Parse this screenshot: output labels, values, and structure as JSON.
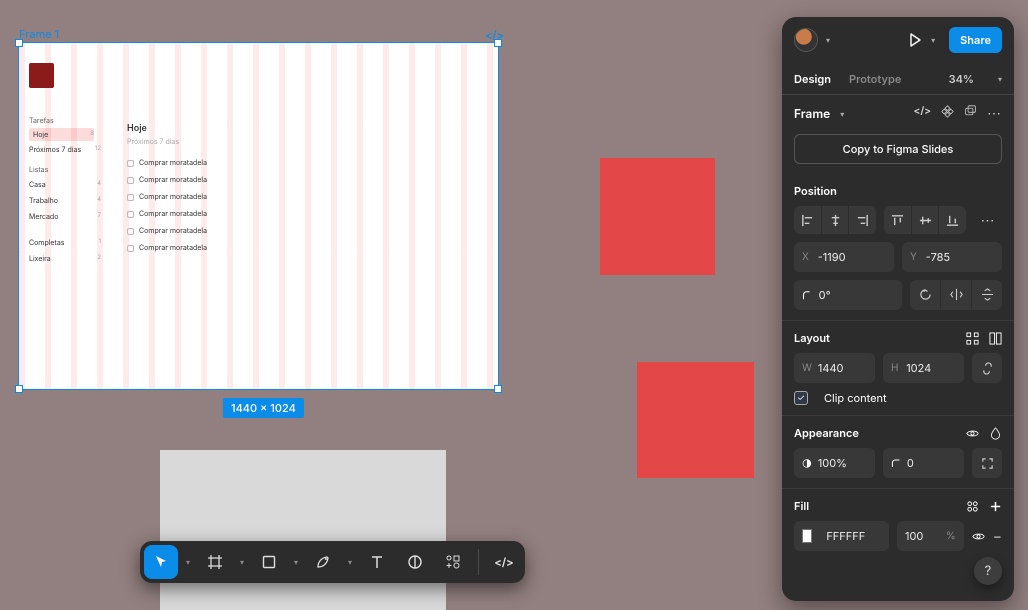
{
  "canvas": {
    "frame_label": "Frame 1",
    "dimensions_badge": "1440 × 1024",
    "mock": {
      "sidebar_h1": "Tarefas",
      "hoje": "Hoje",
      "hoje_n": "8",
      "proximos": "Próximos 7 dias",
      "proximos_n": "12",
      "sidebar_h2": "Listas",
      "casa": "Casa",
      "casa_n": "4",
      "trabalho": "Trabalho",
      "trabalho_n": "4",
      "mercado": "Mercado",
      "mercado_n": "7",
      "completas": "Completas",
      "completas_n": "1",
      "lixeira": "Lixeira",
      "lixeira_n": "2",
      "main_title": "Hoje",
      "filter": "Próximos 7 dias",
      "task": "Comprar moratadela"
    }
  },
  "panel": {
    "share": "Share",
    "tab_design": "Design",
    "tab_prototype": "Prototype",
    "zoom": "34%",
    "frame_kind": "Frame",
    "copy_slides": "Copy to Figma Slides",
    "position_title": "Position",
    "x_lbl": "X",
    "x_val": "-1190",
    "y_lbl": "Y",
    "y_val": "-785",
    "rot_val": "0°",
    "layout_title": "Layout",
    "w_lbl": "W",
    "w_val": "1440",
    "h_lbl": "H",
    "h_val": "1024",
    "clip_content": "Clip content",
    "appearance_title": "Appearance",
    "opacity_val": "100%",
    "radius_val": "0",
    "fill_title": "Fill",
    "fill_hex": "FFFFFF",
    "fill_pct": "100",
    "fill_unit": "%"
  }
}
